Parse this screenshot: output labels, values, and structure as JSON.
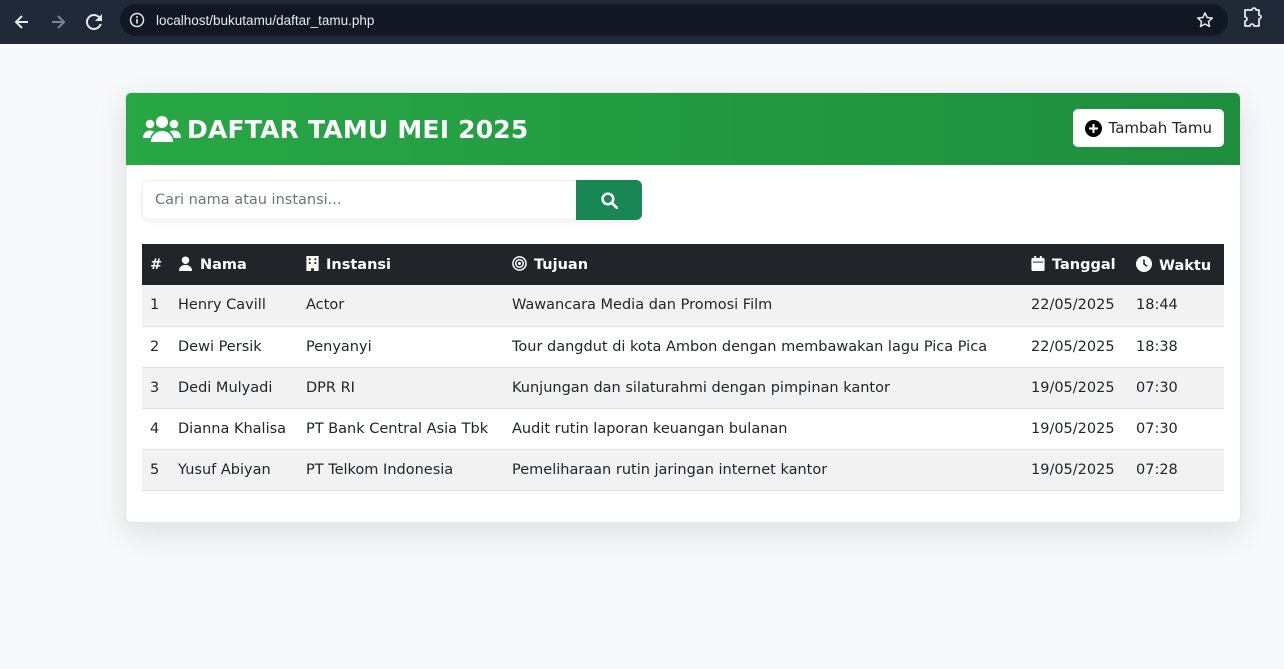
{
  "browser": {
    "url": "localhost/bukutamu/daftar_tamu.php",
    "icons": [
      "back-arrow-icon",
      "forward-arrow-icon",
      "reload-icon",
      "site-info-icon",
      "bookmark-star-icon",
      "extensions-icon"
    ]
  },
  "header": {
    "title": "DAFTAR TAMU MEI 2025",
    "add_button_label": "Tambah Tamu",
    "accent_color": "#28a745"
  },
  "search": {
    "placeholder": "Cari nama atau instansi...",
    "value": "",
    "button_color": "#198754"
  },
  "table": {
    "columns": [
      "#",
      "Nama",
      "Instansi",
      "Tujuan",
      "Tanggal",
      "Waktu"
    ],
    "rows": [
      [
        "1",
        "Henry Cavill",
        "Actor",
        "Wawancara Media dan Promosi Film",
        "22/05/2025",
        "18:44"
      ],
      [
        "2",
        "Dewi Persik",
        "Penyanyi",
        "Tour dangdut di kota Ambon dengan membawakan lagu Pica Pica",
        "22/05/2025",
        "18:38"
      ],
      [
        "3",
        "Dedi Mulyadi",
        "DPR RI",
        "Kunjungan dan silaturahmi dengan pimpinan kantor",
        "19/05/2025",
        "07:30"
      ],
      [
        "4",
        "Dianna Khalisa",
        "PT Bank Central Asia Tbk",
        "Audit rutin laporan keuangan bulanan",
        "19/05/2025",
        "07:30"
      ],
      [
        "5",
        "Yusuf Abiyan",
        "PT Telkom Indonesia",
        "Pemeliharaan rutin jaringan internet kantor",
        "19/05/2025",
        "07:28"
      ]
    ]
  }
}
